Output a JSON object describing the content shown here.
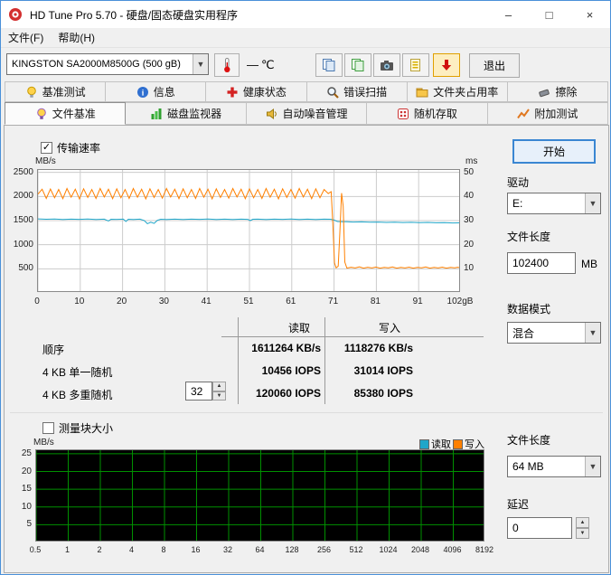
{
  "window": {
    "title": "HD Tune Pro 5.70 - 硬盘/固态硬盘实用程序",
    "minimize": "–",
    "maximize": "□",
    "close": "×"
  },
  "menu": {
    "file": "文件(F)",
    "help": "帮助(H)"
  },
  "toolbar": {
    "drive_select": "KINGSTON SA2000M8500G (500 gB)",
    "temp_value": "—",
    "temp_unit": "℃",
    "exit_label": "退出",
    "icon_names": [
      "thermometer-icon",
      "copy-icon",
      "copy-image-icon",
      "camera-icon",
      "export-icon",
      "update-download-icon"
    ]
  },
  "tabs_row1": [
    {
      "label": "基准测试"
    },
    {
      "label": "信息"
    },
    {
      "label": "健康状态"
    },
    {
      "label": "错误扫描"
    },
    {
      "label": "文件夹占用率"
    },
    {
      "label": "擦除"
    }
  ],
  "tabs_row2": [
    {
      "label": "文件基准",
      "active": true
    },
    {
      "label": "磁盘监视器"
    },
    {
      "label": "自动噪音管理"
    },
    {
      "label": "随机存取"
    },
    {
      "label": "附加测试"
    }
  ],
  "file_benchmark": {
    "transfer_rate_checkbox": "传输速率",
    "transfer_rate_checked": "✓",
    "block_size_checkbox": "测量块大小",
    "legend": {
      "read": "读取",
      "write": "写入"
    },
    "results_table": {
      "col_read": "读取",
      "col_write": "写入",
      "rows": [
        {
          "label": "顺序",
          "read": "1611264 KB/s",
          "write": "1118276 KB/s"
        },
        {
          "label": "4 KB 单一随机",
          "read": "10456 IOPS",
          "write": "31014 IOPS"
        },
        {
          "label": "4 KB 多重随机",
          "queue_depth": "32",
          "read": "120060 IOPS",
          "write": "85380 IOPS"
        }
      ]
    }
  },
  "right_panel": {
    "start_button": "开始",
    "drive_label": "驱动",
    "drive_value": "E:",
    "file_length_label": "文件长度",
    "file_length_value": "102400",
    "file_length_unit": "MB",
    "data_mode_label": "数据模式",
    "data_mode_value": "混合",
    "file_length2_label": "文件长度",
    "file_length2_value": "64 MB",
    "delay_label": "延迟",
    "delay_value": "0"
  },
  "colors": {
    "read": "#1fa6c9",
    "write": "#ff8000",
    "accent": "#3a86d2"
  },
  "chart_data": [
    {
      "id": "transfer-chart",
      "type": "line",
      "title": "传输速率",
      "ylabel_left": "MB/s",
      "ylabel_right": "ms",
      "ylim": [
        0,
        2550
      ],
      "ytick_values": [
        2500,
        2000,
        1500,
        1000,
        500
      ],
      "yticks_left": [
        "2500",
        "2000",
        "1500",
        "1000",
        "500"
      ],
      "yticks_right": [
        "50",
        "40",
        "30",
        "20",
        "10"
      ],
      "xlim": [
        0,
        102
      ],
      "xtick_values": [
        0,
        10.2,
        20.4,
        30.6,
        40.8,
        51,
        61.2,
        71.4,
        81.6,
        91.8,
        102
      ],
      "xtick_labels": [
        "0",
        "10",
        "20",
        "30",
        "41",
        "51",
        "61",
        "71",
        "81",
        "91",
        "102gB"
      ],
      "bg": "#ffffff",
      "grid_color": "#cccccc",
      "grid": true,
      "legend_position": "none",
      "series": [
        {
          "name": "读取",
          "color": "#1fa6c9",
          "points": [
            [
              0,
              1535
            ],
            [
              2,
              1528
            ],
            [
              4,
              1532
            ],
            [
              6,
              1524
            ],
            [
              8,
              1530
            ],
            [
              10,
              1526
            ],
            [
              12,
              1532
            ],
            [
              14,
              1525
            ],
            [
              16,
              1530
            ],
            [
              17,
              1492
            ],
            [
              17.6,
              1528
            ],
            [
              19,
              1526
            ],
            [
              20.6,
              1530
            ],
            [
              21.2,
              1482
            ],
            [
              21.8,
              1528
            ],
            [
              23,
              1524
            ],
            [
              24.6,
              1530
            ],
            [
              25.6,
              1502
            ],
            [
              26.4,
              1436
            ],
            [
              27.2,
              1466
            ],
            [
              28,
              1442
            ],
            [
              28.8,
              1506
            ],
            [
              29.6,
              1528
            ],
            [
              31,
              1525
            ],
            [
              33,
              1530
            ],
            [
              35,
              1524
            ],
            [
              37,
              1530
            ],
            [
              39,
              1526
            ],
            [
              41,
              1532
            ],
            [
              43,
              1525
            ],
            [
              45,
              1530
            ],
            [
              47,
              1524
            ],
            [
              49,
              1530
            ],
            [
              50.6,
              1526
            ],
            [
              51.2,
              1500
            ],
            [
              51.8,
              1528
            ],
            [
              53,
              1530
            ],
            [
              55,
              1524
            ],
            [
              57,
              1530
            ],
            [
              59,
              1526
            ],
            [
              61,
              1532
            ],
            [
              63,
              1525
            ],
            [
              65,
              1530
            ],
            [
              67,
              1524
            ],
            [
              69,
              1530
            ],
            [
              70.6,
              1528
            ],
            [
              71.4,
              1512
            ],
            [
              72.2,
              1482
            ],
            [
              73.2,
              1475
            ],
            [
              74.5,
              1478
            ],
            [
              76,
              1470
            ],
            [
              78,
              1474
            ],
            [
              80,
              1466
            ],
            [
              82,
              1470
            ],
            [
              84,
              1463
            ],
            [
              86,
              1468
            ],
            [
              88,
              1460
            ],
            [
              90,
              1464
            ],
            [
              92,
              1457
            ],
            [
              94,
              1462
            ],
            [
              96,
              1455
            ],
            [
              98,
              1458
            ],
            [
              100,
              1452
            ],
            [
              102,
              1455
            ]
          ]
        },
        {
          "name": "写入",
          "color": "#ff8000",
          "points": [
            [
              0,
              2050
            ],
            [
              1,
              2150
            ],
            [
              2,
              1960
            ],
            [
              3,
              2155
            ],
            [
              4,
              1975
            ],
            [
              5,
              2145
            ],
            [
              6,
              1955
            ],
            [
              7,
              2165
            ],
            [
              8,
              1985
            ],
            [
              9,
              2150
            ],
            [
              10,
              1950
            ],
            [
              11,
              2160
            ],
            [
              12,
              1980
            ],
            [
              13,
              2145
            ],
            [
              14,
              1960
            ],
            [
              15,
              2165
            ],
            [
              16,
              1990
            ],
            [
              17,
              2150
            ],
            [
              18,
              1955
            ],
            [
              19,
              2160
            ],
            [
              20,
              1975
            ],
            [
              21,
              2145
            ],
            [
              22,
              1960
            ],
            [
              23,
              2165
            ],
            [
              24,
              1985
            ],
            [
              25,
              2150
            ],
            [
              26,
              1950
            ],
            [
              27,
              2160
            ],
            [
              28,
              1980
            ],
            [
              29,
              2145
            ],
            [
              30,
              1965
            ],
            [
              31,
              2165
            ],
            [
              32,
              1990
            ],
            [
              33,
              2150
            ],
            [
              34,
              1955
            ],
            [
              35,
              2160
            ],
            [
              36,
              1975
            ],
            [
              37,
              2145
            ],
            [
              38,
              1960
            ],
            [
              39,
              2165
            ],
            [
              40,
              1985
            ],
            [
              41,
              2150
            ],
            [
              42,
              1950
            ],
            [
              43,
              2160
            ],
            [
              44,
              1980
            ],
            [
              45,
              2145
            ],
            [
              46,
              1965
            ],
            [
              47,
              2165
            ],
            [
              48,
              1990
            ],
            [
              49,
              2150
            ],
            [
              50,
              1955
            ],
            [
              51,
              2160
            ],
            [
              52,
              1975
            ],
            [
              53,
              2145
            ],
            [
              54,
              1960
            ],
            [
              55,
              2165
            ],
            [
              56,
              1985
            ],
            [
              57,
              2150
            ],
            [
              58,
              1950
            ],
            [
              59,
              2160
            ],
            [
              60,
              1980
            ],
            [
              61,
              2145
            ],
            [
              62,
              1965
            ],
            [
              63,
              2165
            ],
            [
              64,
              1990
            ],
            [
              65,
              2150
            ],
            [
              66,
              1955
            ],
            [
              67,
              2160
            ],
            [
              68,
              1975
            ],
            [
              69,
              2145
            ],
            [
              70,
              2060
            ],
            [
              70.7,
              2100
            ],
            [
              71.1,
              1450
            ],
            [
              71.5,
              620
            ],
            [
              71.9,
              520
            ],
            [
              72.4,
              555
            ],
            [
              72.8,
              1250
            ],
            [
              73.2,
              2070
            ],
            [
              73.6,
              1800
            ],
            [
              74,
              640
            ],
            [
              74.5,
              515
            ],
            [
              75.5,
              532
            ],
            [
              76.5,
              518
            ],
            [
              77.5,
              540
            ],
            [
              78.5,
              514
            ],
            [
              79.5,
              533
            ],
            [
              80.5,
              517
            ],
            [
              81.5,
              536
            ],
            [
              82.5,
              514
            ],
            [
              83.5,
              530
            ],
            [
              84.5,
              519
            ],
            [
              85.5,
              538
            ],
            [
              86.5,
              514
            ],
            [
              87.5,
              531
            ],
            [
              88.5,
              517
            ],
            [
              89.5,
              535
            ],
            [
              90.5,
              514
            ],
            [
              91.5,
              530
            ],
            [
              92.5,
              519
            ],
            [
              93.5,
              538
            ],
            [
              94.5,
              514
            ],
            [
              95.5,
              531
            ],
            [
              96.5,
              517
            ],
            [
              97.5,
              535
            ],
            [
              98.5,
              514
            ],
            [
              99.5,
              530
            ],
            [
              100.5,
              519
            ],
            [
              101.2,
              533
            ],
            [
              102,
              524
            ]
          ]
        }
      ]
    },
    {
      "id": "blocksize-chart",
      "type": "line",
      "title": "测量块大小",
      "ylabel_left": "MB/s",
      "ylim": [
        0,
        26
      ],
      "ytick_values": [
        25,
        20,
        15,
        10,
        5
      ],
      "yticks_left": [
        "25",
        "20",
        "15",
        "10",
        "5"
      ],
      "xtick_labels": [
        "0.5",
        "1",
        "2",
        "4",
        "8",
        "16",
        "32",
        "64",
        "128",
        "256",
        "512",
        "1024",
        "2048",
        "4096",
        "8192"
      ],
      "bg": "#000000",
      "grid_color": "#009000",
      "grid": true,
      "legend_position": "top-right",
      "series": []
    }
  ]
}
